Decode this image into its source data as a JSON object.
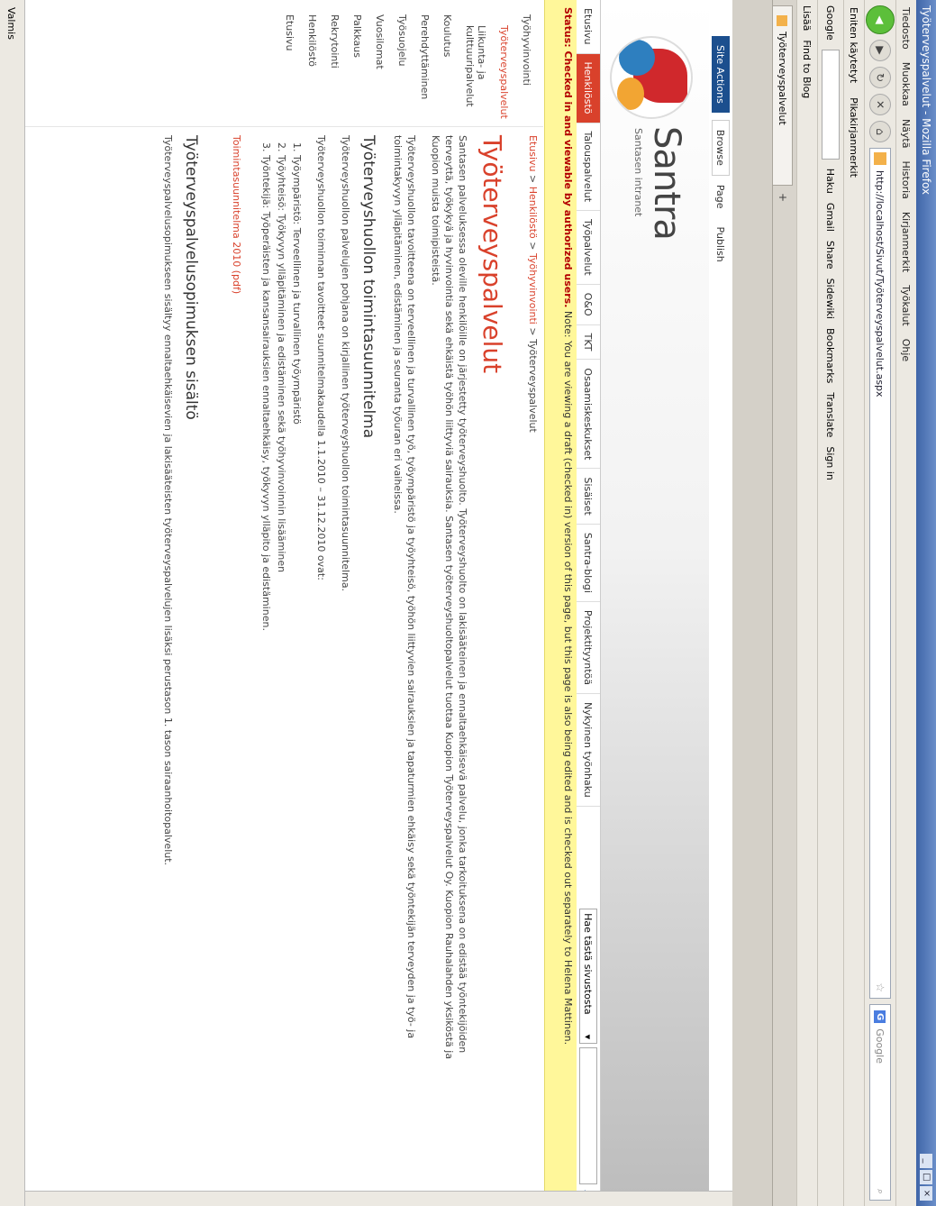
{
  "window": {
    "title": "Työterveyspalvelut - Mozilla Firefox",
    "controls": [
      "_",
      "□",
      "×"
    ]
  },
  "menu": [
    "Tiedosto",
    "Muokkaa",
    "Näytä",
    "Historia",
    "Kirjanmerkit",
    "Työkalut",
    "Ohje"
  ],
  "nav": {
    "url": "http://localhost/Sivut/Työterveyspalvelut.aspx",
    "search_placeholder": "Google"
  },
  "bookmarks": [
    "Eniten käytetyt",
    "Pikakirjanmerkit"
  ],
  "toolbar2": {
    "label": "Google",
    "items": [
      "Haku",
      "Gmail",
      "Share",
      "Sidewiki",
      "Bookmarks",
      "Translate",
      "Sign in"
    ]
  },
  "toolbar3": {
    "items": [
      "Lisää",
      "Find to Blog"
    ]
  },
  "tab": {
    "label": "Työterveyspalvelut",
    "plus": "+"
  },
  "ribbon": {
    "site_actions": "Site Actions",
    "browse": "Browse",
    "page": "Page",
    "publish": "Publish"
  },
  "brand": {
    "name": "Santra",
    "subtitle": "Santasen intranet"
  },
  "topnav": [
    "Etusivu",
    "Henkilöstö",
    "Talouspalvelut",
    "Työpalvelut",
    "O&O",
    "TKT",
    "Osaamiskeskukset",
    "Sisäiset",
    "Santra-blogi",
    "Projektityyntöä",
    "Nykyinen työnhaku"
  ],
  "search": {
    "scope": "Hae tästä sivustosta",
    "go": "⌕"
  },
  "notice": {
    "status": "Status: Checked in and viewable by authorized users.",
    "text": "Note: You are viewing a draft (checked in) version of this page, but this page is also being edited and is checked out separately to Helena Mattinen."
  },
  "leftnav": [
    "Työhyvinvointi",
    "Työterveyspalvelut",
    "Liikunta- ja kulttuuripalvelut",
    "Koulutus",
    "Perehdyttäminen",
    "Työsuojelu",
    "Vuosilomat",
    "Palkkaus",
    "Rekrytointi",
    "Henkilöstö",
    "Etusivu"
  ],
  "breadcrumb": {
    "root": "Etusivu",
    "sep1": " > ",
    "level1": "Henkilöstö",
    "sep2": " > ",
    "level2": "Työhyvinvointi",
    "sep3": " > ",
    "current": "Työterveyspalvelut"
  },
  "main": {
    "title": "Työterveyspalvelut",
    "p1": "Santasen palveluksessa oleville henkilöille on järjestetty työterveyshuolto. Työterveyshuolto on lakisääteinen ja ennaltaehkäisevä palvelu, jonka tarkoituksena on edistää työntekijöiden terveyttä, työkykyä ja hyvinvointia sekä ehkäistä työhön liittyviä sairauksia. Santasen työterveyshuoltopalvelut tuottaa Kuopion Työterveyspalvelut Oy. Kuopion Rauhalahden yksiköstä ja Kuopion muista toimipisteistä.",
    "p2": "Työterveyshuollon tavoitteena on terveellinen ja turvallinen työ, työympäristö ja työyhteisö, työhön liittyvien sairauksien ja tapaturmien ehkäisy sekä työntekijän terveyden ja työ- ja toimintakyvyn ylläpitäminen, edistäminen ja seuranta työuran eri vaiheissa.",
    "h2_1": "Työterveyshuollon toimintasuunnitelma",
    "p3": "Työterveyshuollon palvelujen pohjana on kirjallinen työterveyshuollon toimintasuunnitelma.",
    "p4": "Työterveyshuollon toiminnan tavoitteet suunnitelmakaudella 1.1.2010 – 31.12.2010 ovat:",
    "list": [
      "Työympäristö: Terveellinen ja turvallinen työympäristö",
      "Työyhteisö: Työkyvyn ylläpitäminen ja edistäminen sekä työhyvinvoinnin lisääminen",
      "Työntekijä: Työperäisten ja kansansairauksien ennaltaehkäisy, työkyvyn ylläpito ja edistäminen."
    ],
    "pdf": "Toimintasuunnitelma 2010 (pdf)",
    "h2_2": "Työterveyspalvelusopimuksen sisältö",
    "p5": "Työterveyspalvelusopimukseen sisältyy ennaltaehkäisevien ja lakisääteisten työterveyspalvelujen lisäksi perustason 1. tason sairaanhoitopalvelut."
  },
  "status": "Valmis"
}
